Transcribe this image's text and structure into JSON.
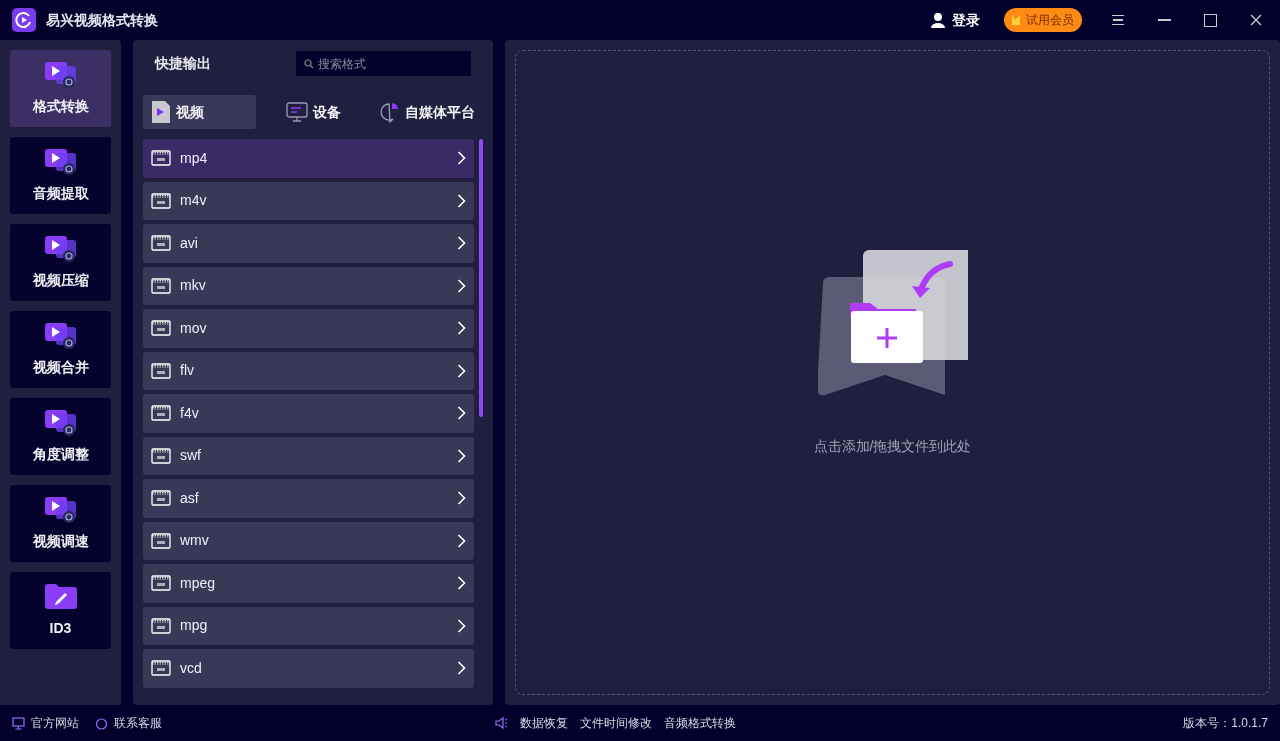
{
  "window": {
    "title": "易兴视频格式转换"
  },
  "header": {
    "login": "登录",
    "vip": "试用会员"
  },
  "sidebar": {
    "items": [
      {
        "label": "格式转换",
        "selected": true
      },
      {
        "label": "音频提取",
        "selected": false
      },
      {
        "label": "视频压缩",
        "selected": false
      },
      {
        "label": "视频合并",
        "selected": false
      },
      {
        "label": "角度调整",
        "selected": false
      },
      {
        "label": "视频调速",
        "selected": false
      },
      {
        "label": "ID3",
        "selected": false
      }
    ]
  },
  "panel": {
    "title": "快捷输出",
    "search": {
      "placeholder": "搜索格式"
    },
    "tabs": [
      {
        "label": "视频",
        "kind": "video",
        "selected": true
      },
      {
        "label": "设备",
        "kind": "device",
        "selected": false
      },
      {
        "label": "自媒体平台",
        "kind": "media",
        "selected": false
      }
    ],
    "formats": [
      {
        "label": "mp4",
        "selected": true
      },
      {
        "label": "m4v",
        "selected": false
      },
      {
        "label": "avi",
        "selected": false
      },
      {
        "label": "mkv",
        "selected": false
      },
      {
        "label": "mov",
        "selected": false
      },
      {
        "label": "flv",
        "selected": false
      },
      {
        "label": "f4v",
        "selected": false
      },
      {
        "label": "swf",
        "selected": false
      },
      {
        "label": "asf",
        "selected": false
      },
      {
        "label": "wmv",
        "selected": false
      },
      {
        "label": "mpeg",
        "selected": false
      },
      {
        "label": "mpg",
        "selected": false
      },
      {
        "label": "vcd",
        "selected": false
      }
    ]
  },
  "dropzone": {
    "hint": "点击添加/拖拽文件到此处"
  },
  "status_bar": {
    "left": [
      "官方网站",
      "联系客服"
    ],
    "center": [
      "数据恢复",
      "文件时间修改",
      "音频格式转换"
    ],
    "version": "版本号：1.0.1.7"
  }
}
